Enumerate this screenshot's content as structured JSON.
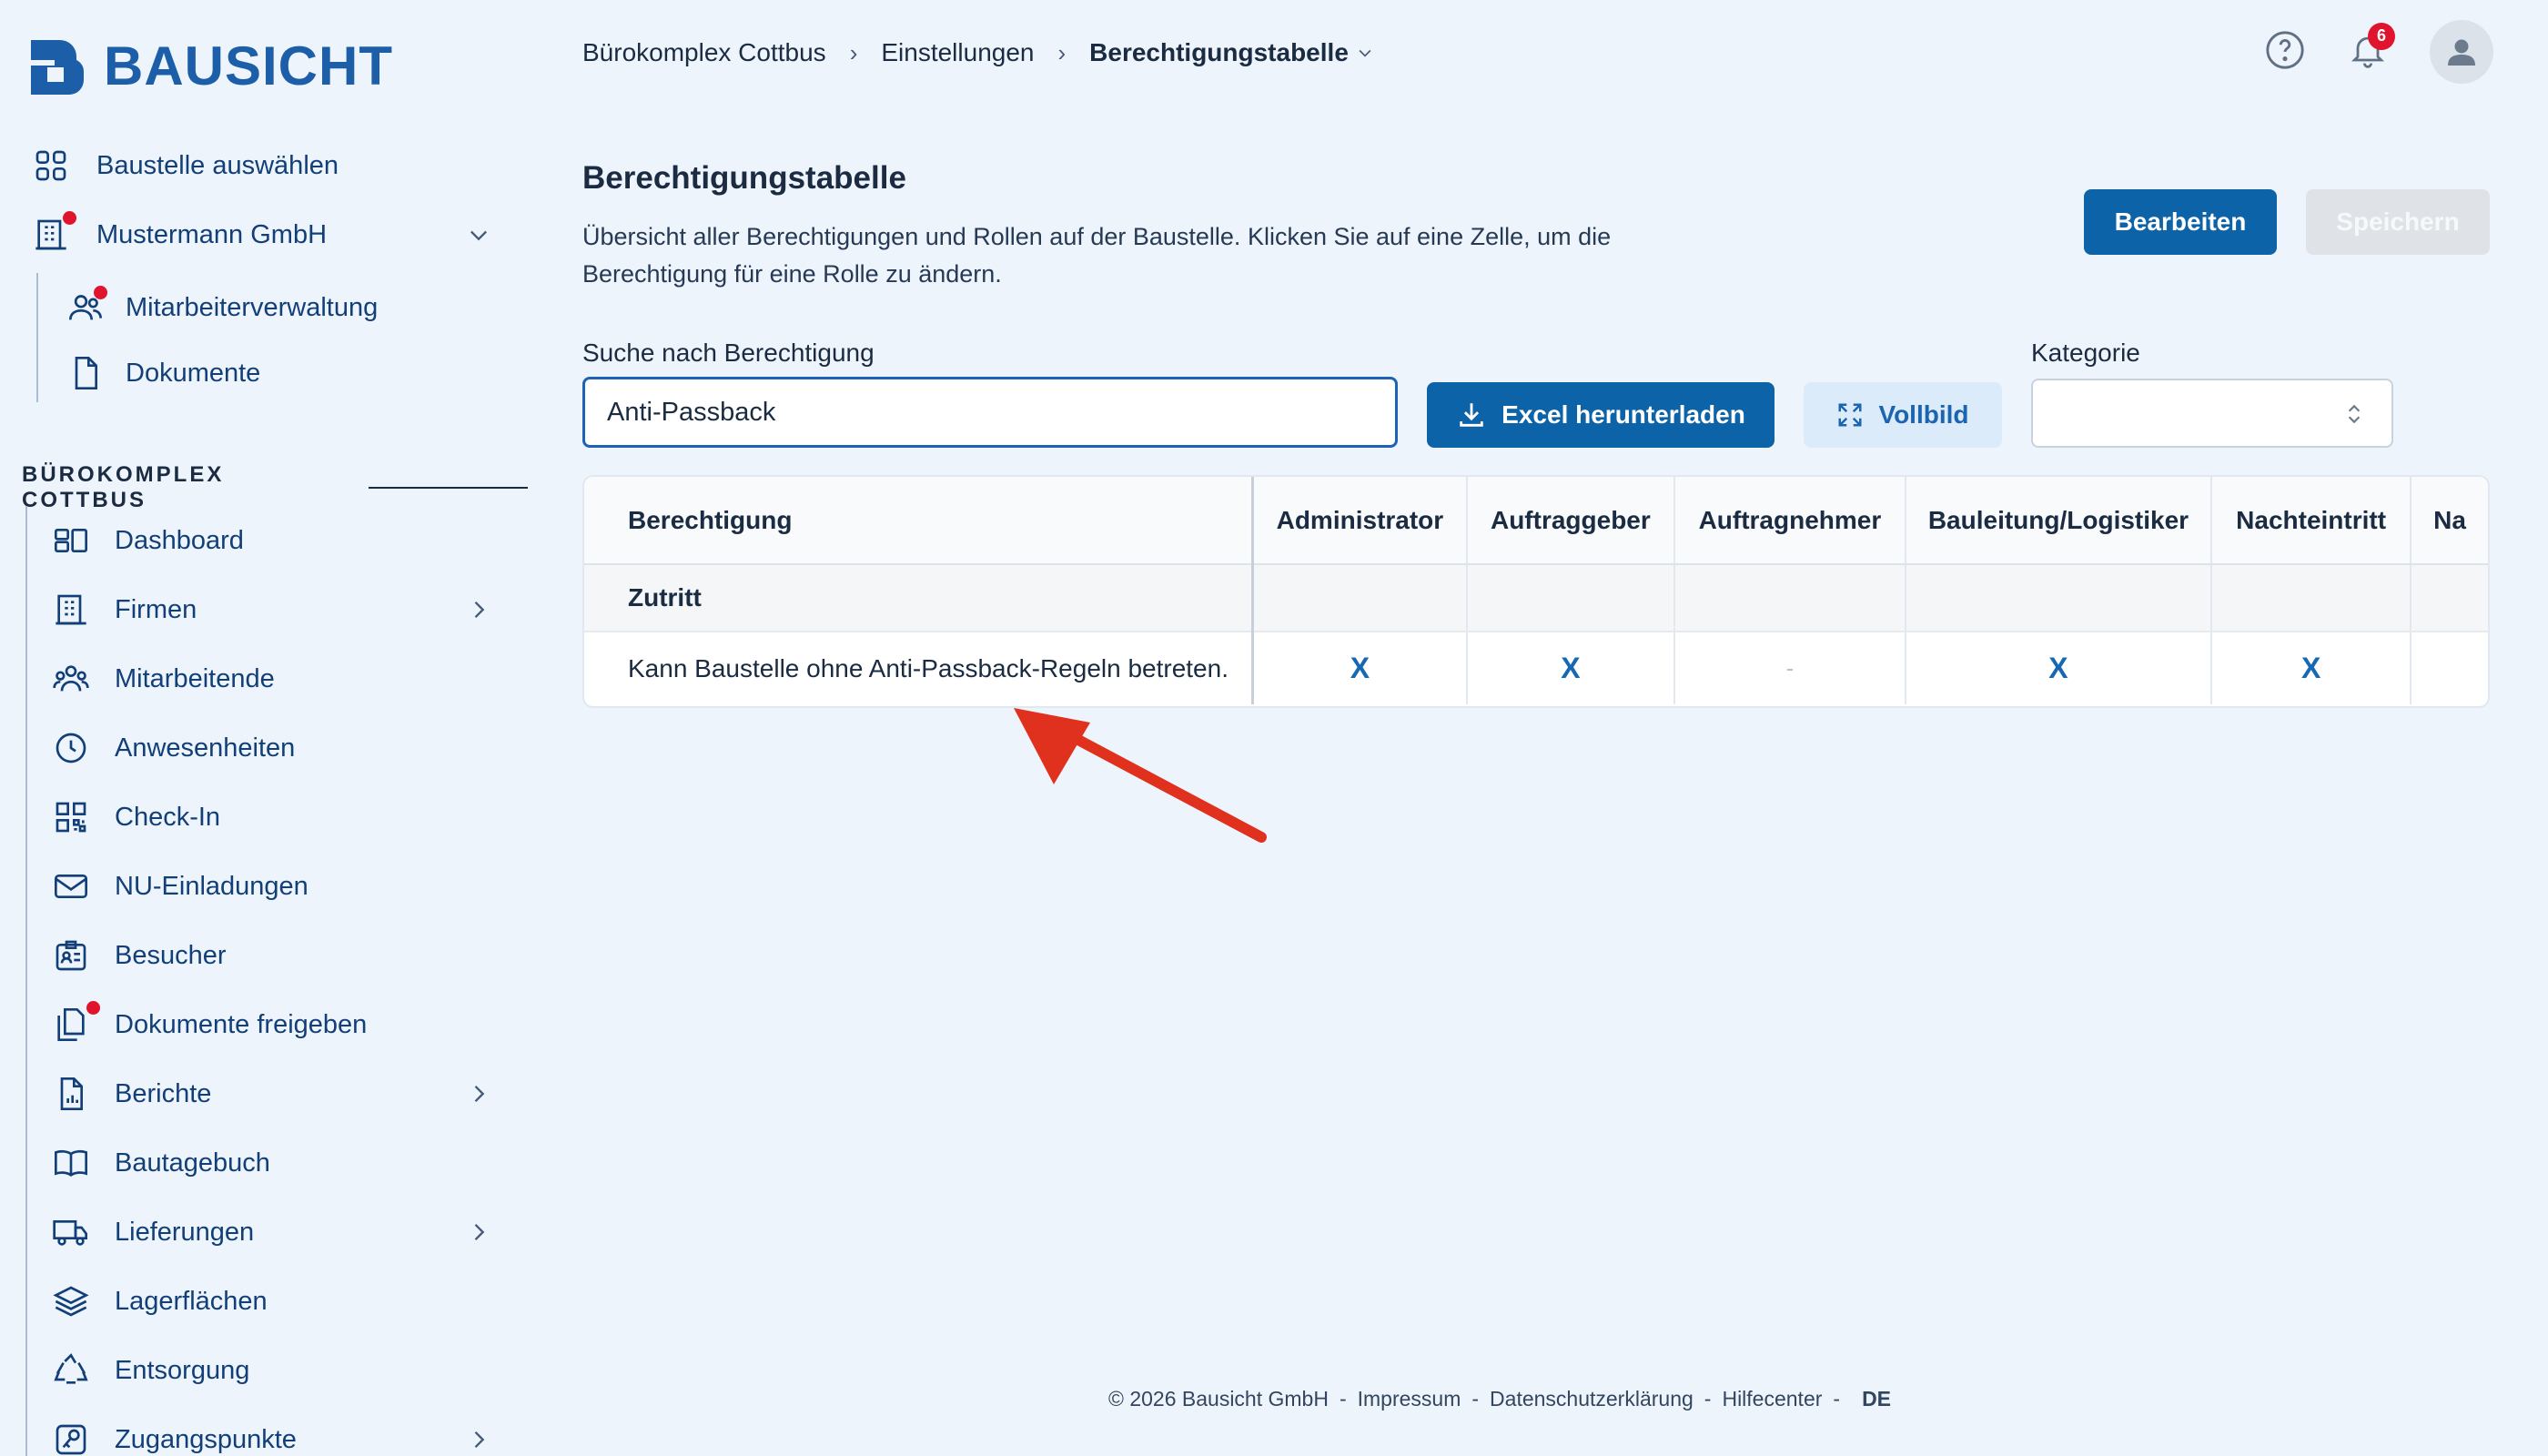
{
  "brand": {
    "name": "BAUSICHT",
    "color": "#1c5fa8"
  },
  "sidebar": {
    "select_site": "Baustelle auswählen",
    "company": "Mustermann GmbH",
    "company_items": [
      "Mitarbeiterverwaltung",
      "Dokumente"
    ],
    "section_title": "BÜROKOMPLEX COTTBUS",
    "items": [
      {
        "label": "Dashboard",
        "icon": "dashboard-icon"
      },
      {
        "label": "Firmen",
        "icon": "building-icon"
      },
      {
        "label": "Mitarbeitende",
        "icon": "users-icon"
      },
      {
        "label": "Anwesenheiten",
        "icon": "clock-icon"
      },
      {
        "label": "Check-In",
        "icon": "qr-code-icon"
      },
      {
        "label": "NU-Einladungen",
        "icon": "mail-icon"
      },
      {
        "label": "Besucher",
        "icon": "id-badge-icon"
      },
      {
        "label": "Dokumente freigeben",
        "icon": "documents-icon"
      },
      {
        "label": "Berichte",
        "icon": "report-icon"
      },
      {
        "label": "Bautagebuch",
        "icon": "book-icon"
      },
      {
        "label": "Lieferungen",
        "icon": "truck-icon"
      },
      {
        "label": "Lagerflächen",
        "icon": "layers-icon"
      },
      {
        "label": "Entsorgung",
        "icon": "recycle-icon"
      },
      {
        "label": "Zugangspunkte",
        "icon": "key-icon"
      }
    ]
  },
  "breadcrumb": [
    "Bürokomplex Cottbus",
    "Einstellungen",
    "Berechtigungstabelle"
  ],
  "notifications": {
    "count": "6"
  },
  "page": {
    "title": "Berechtigungstabelle",
    "description": "Übersicht aller Berechtigungen und Rollen auf der Baustelle. Klicken Sie auf eine Zelle, um die Berechtigung für eine Rolle zu ändern.",
    "edit_label": "Bearbeiten",
    "save_label": "Speichern"
  },
  "filters": {
    "search_label": "Suche nach Berechtigung",
    "search_value": "Anti-Passback",
    "excel_label": "Excel herunterladen",
    "fullscreen_label": "Vollbild",
    "category_label": "Kategorie",
    "category_value": ""
  },
  "table": {
    "first_header": "Berechtigung",
    "columns": [
      "Administrator",
      "Auftraggeber",
      "Auftragnehmer",
      "Bauleitung/Logistiker",
      "Nachteintritt",
      "Na"
    ],
    "category": "Zutritt",
    "rows": [
      {
        "label": "Kann Baustelle ohne Anti-Passback-Regeln betreten.",
        "cells": [
          "X",
          "X",
          "-",
          "X",
          "X",
          ""
        ]
      }
    ]
  },
  "footer": {
    "copyright": "© 2026 Bausicht GmbH",
    "links": [
      "Impressum",
      "Datenschutzerklärung",
      "Hilfecenter"
    ],
    "separator": "-",
    "language": "DE"
  },
  "colors": {
    "primary": "#0d63a8",
    "accent_red": "#e0142d",
    "arrow": "#e0301e"
  }
}
